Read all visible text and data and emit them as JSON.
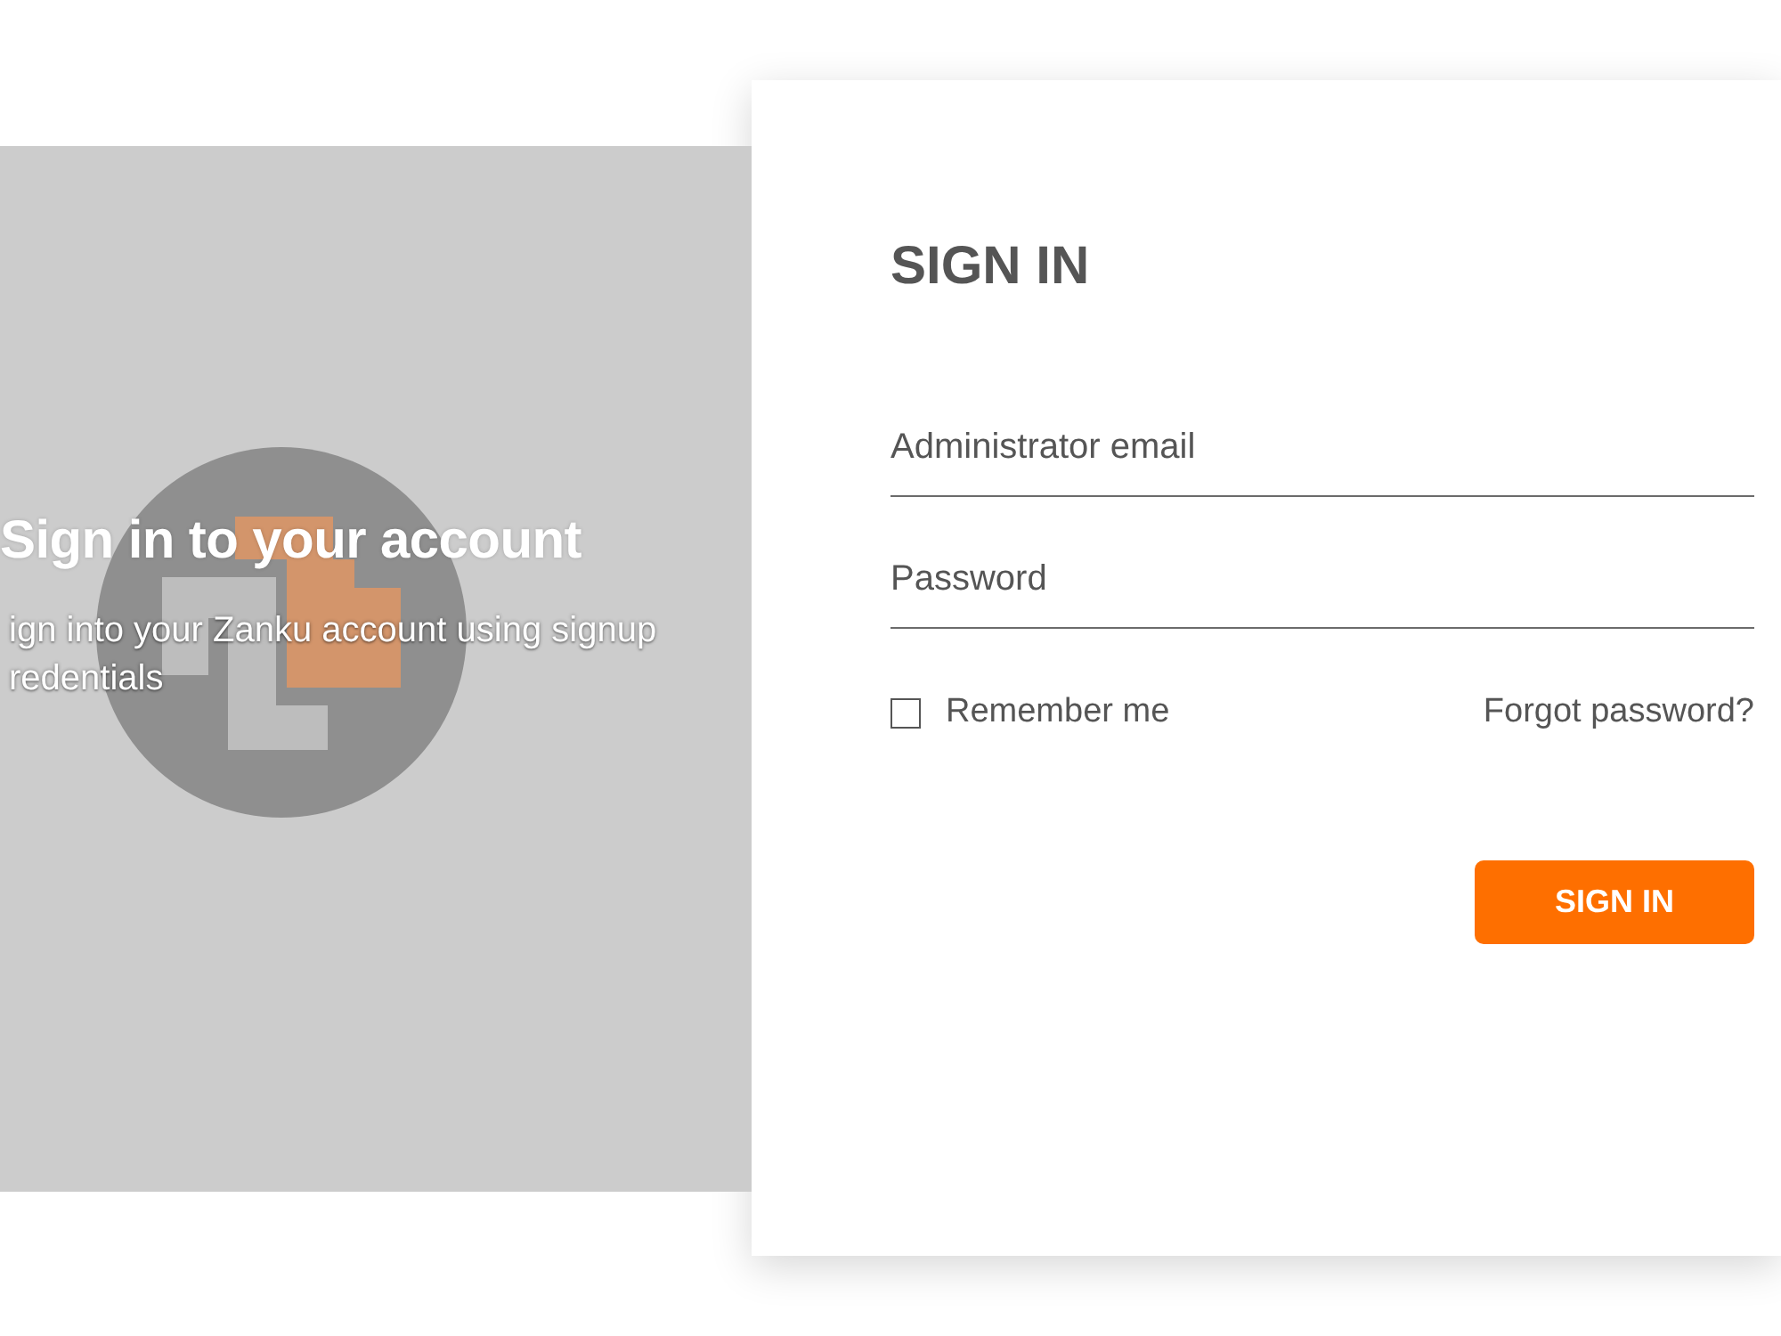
{
  "left_panel": {
    "heading": "Sign in to your account",
    "subtitle": "ign into your Zanku account using signup redentials"
  },
  "form": {
    "title": "SIGN IN",
    "fields": [
      {
        "placeholder": "Administrator email"
      },
      {
        "placeholder": "Password"
      }
    ],
    "remember": {
      "label": "Remember me",
      "checked": false
    },
    "forgot_link": "Forgot password?",
    "submit": "SIGN IN"
  }
}
